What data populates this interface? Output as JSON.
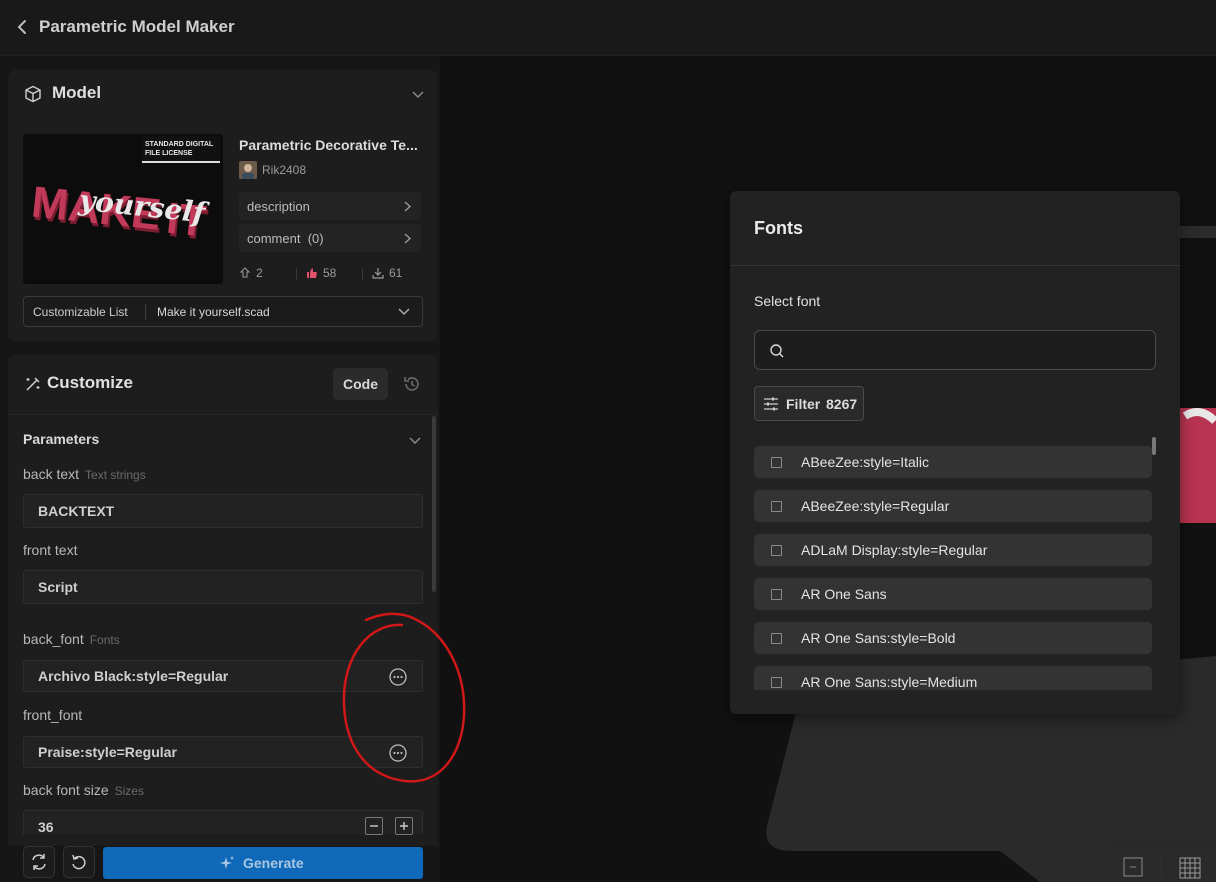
{
  "header": {
    "title": "Parametric Model Maker"
  },
  "model": {
    "section_title": "Model",
    "name": "Parametric Decorative Te...",
    "license_line1": "STANDARD DIGITAL",
    "license_line2": "FILE LICENSE",
    "thumb_text1": "MAKE",
    "thumb_text2": "yourself",
    "thumb_text3": "IT",
    "author": "Rik2408",
    "description_label": "description",
    "comment_label": "comment",
    "comment_count": "(0)",
    "stats": {
      "boosts": "2",
      "likes": "58",
      "downloads": "61"
    },
    "list_label": "Customizable List",
    "file": "Make it yourself.scad"
  },
  "customize": {
    "section_title": "Customize",
    "code_label": "Code",
    "params_title": "Parameters",
    "fields": [
      {
        "label": "back text",
        "hint": "Text strings",
        "value": "BACKTEXT"
      },
      {
        "label": "front text",
        "hint": "",
        "value": "Script"
      },
      {
        "label": "back_font",
        "hint": "Fonts",
        "value": "Archivo Black:style=Regular"
      },
      {
        "label": "front_font",
        "hint": "",
        "value": "Praise:style=Regular"
      },
      {
        "label": "back font size",
        "hint": "Sizes",
        "value": "36"
      }
    ],
    "generate_label": "Generate"
  },
  "fonts_panel": {
    "title": "Fonts",
    "select_label": "Select font",
    "search_placeholder": "",
    "filter_label": "Filter",
    "filter_count": "8267",
    "fonts": [
      "ABeeZee:style=Italic",
      "ABeeZee:style=Regular",
      "ADLaM Display:style=Regular",
      "AR One Sans",
      "AR One Sans:style=Bold",
      "AR One Sans:style=Medium"
    ]
  },
  "colors": {
    "accent": "#1068b8",
    "annotation": "#d01818",
    "model_pink": "#c23a5a"
  }
}
